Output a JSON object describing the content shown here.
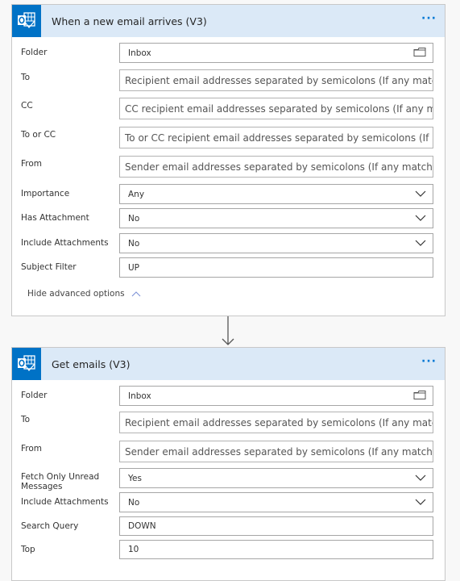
{
  "trigger_card": {
    "title": "When a new email arrives (V3)",
    "icon": "outlook-icon",
    "more_label": "···",
    "fields": {
      "folder": {
        "label": "Folder",
        "value": "Inbox",
        "icon": "folder-icon"
      },
      "to": {
        "label": "To",
        "placeholder": "Recipient email addresses separated by semicolons (If any match, th"
      },
      "cc": {
        "label": "CC",
        "placeholder": "CC recipient email addresses separated by semicolons (If any match"
      },
      "to_or_cc": {
        "label": "To or CC",
        "placeholder": "To or CC recipient email addresses separated by semicolons (If any ı"
      },
      "from": {
        "label": "From",
        "placeholder": "Sender email addresses separated by semicolons (If any match, the"
      },
      "importance": {
        "label": "Importance",
        "value": "Any"
      },
      "has_attachment": {
        "label": "Has Attachment",
        "value": "No"
      },
      "include_attachments": {
        "label": "Include Attachments",
        "value": "No"
      },
      "subject_filter": {
        "label": "Subject Filter",
        "value": "UP"
      }
    },
    "advanced_toggle": "Hide advanced options"
  },
  "action_card": {
    "title": "Get emails (V3)",
    "icon": "outlook-icon",
    "more_label": "···",
    "fields": {
      "folder": {
        "label": "Folder",
        "value": "Inbox",
        "icon": "folder-icon"
      },
      "to": {
        "label": "To",
        "placeholder": "Recipient email addresses separated by semicolons (If any match, th"
      },
      "from": {
        "label": "From",
        "placeholder": "Sender email addresses separated by semicolons (If any match, the"
      },
      "fetch_unread": {
        "label": "Fetch Only Unread Messages",
        "value": "Yes"
      },
      "include_attachments": {
        "label": "Include Attachments",
        "value": "No"
      },
      "search_query": {
        "label": "Search Query",
        "value": "DOWN"
      },
      "top": {
        "label": "Top",
        "value": "10"
      }
    }
  },
  "colors": {
    "accent": "#0072c6",
    "header_bg": "#dbe9f7",
    "page_bg": "#f8f8f8"
  }
}
